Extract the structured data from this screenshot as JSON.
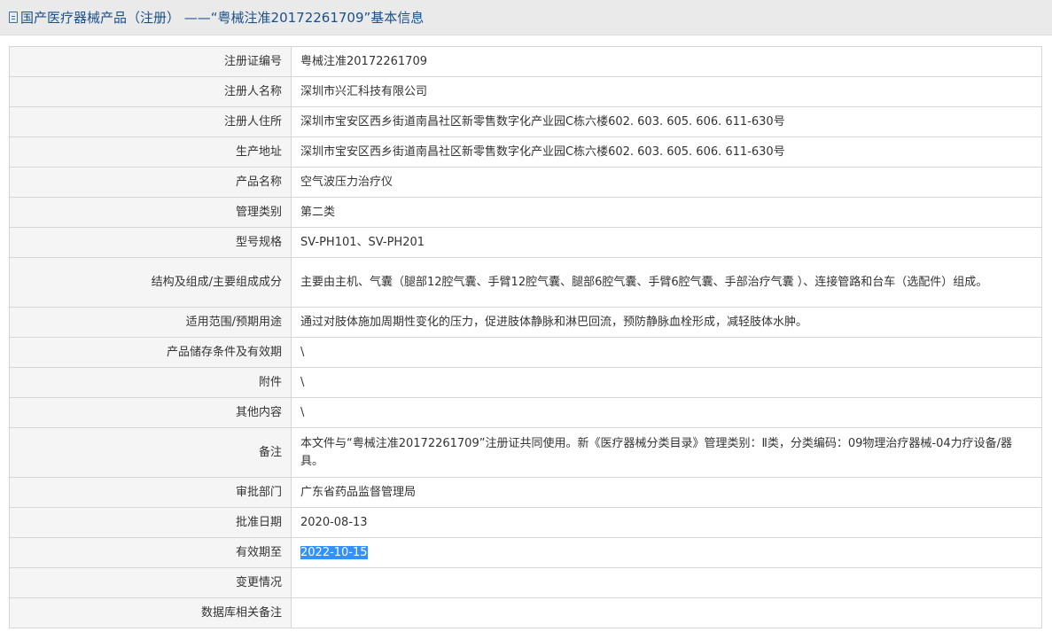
{
  "header": {
    "title": "国产医疗器械产品（注册） ——“粤械注准20172261709”基本信息"
  },
  "rows": [
    {
      "label": "注册证编号",
      "value": "粤械注准20172261709"
    },
    {
      "label": "注册人名称",
      "value": "深圳市兴汇科技有限公司"
    },
    {
      "label": "注册人住所",
      "value": "深圳市宝安区西乡街道南昌社区新零售数字化产业园C栋六楼602. 603. 605. 606. 611-630号"
    },
    {
      "label": "生产地址",
      "value": "深圳市宝安区西乡街道南昌社区新零售数字化产业园C栋六楼602. 603. 605. 606. 611-630号"
    },
    {
      "label": "产品名称",
      "value": "空气波压力治疗仪"
    },
    {
      "label": "管理类别",
      "value": "第二类"
    },
    {
      "label": "型号规格",
      "value": "SV-PH101、SV-PH201"
    },
    {
      "label": "结构及组成/主要组成成分",
      "value": "主要由主机、气囊（腿部12腔气囊、手臂12腔气囊、腿部6腔气囊、手臂6腔气囊、手部治疗气囊 ）、连接管路和台车（选配件）组成。"
    },
    {
      "label": "适用范围/预期用途",
      "value": "通过对肢体施加周期性变化的压力，促进肢体静脉和淋巴回流，预防静脉血栓形成，减轻肢体水肿。"
    },
    {
      "label": "产品储存条件及有效期",
      "value": "\\"
    },
    {
      "label": "附件",
      "value": "\\"
    },
    {
      "label": "其他内容",
      "value": "\\"
    },
    {
      "label": "备注",
      "value": "本文件与“粤械注准20172261709”注册证共同使用。新《医疗器械分类目录》管理类别：Ⅱ类，分类编码：09物理治疗器械-04力疗设备/器具。"
    },
    {
      "label": "审批部门",
      "value": "广东省药品监督管理局"
    },
    {
      "label": "批准日期",
      "value": "2020-08-13"
    },
    {
      "label": "有效期至",
      "value": "2022-10-15"
    },
    {
      "label": "变更情况",
      "value": ""
    },
    {
      "label": "数据库相关备注",
      "value": ""
    }
  ],
  "colors": {
    "title_text": "#1a4f8b",
    "label_bg": "#f5f5f5",
    "border": "#d6d6d6",
    "selection": "#3390ff"
  },
  "icons": {
    "title_icon": "document-icon"
  }
}
